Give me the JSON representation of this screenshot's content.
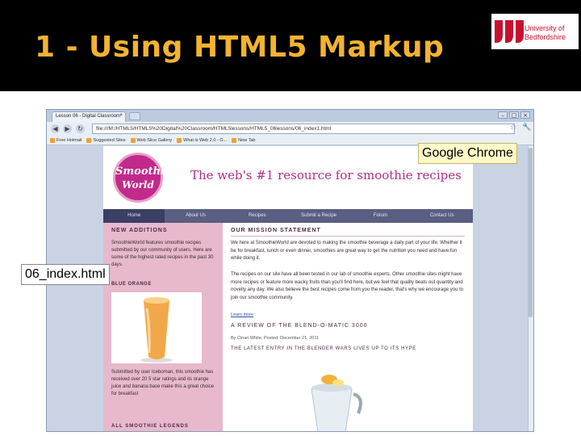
{
  "slide": {
    "title": "1 - Using HTML5 Markup",
    "logo_text": [
      "University of",
      "Bedfordshire"
    ]
  },
  "callouts": {
    "browser": "Google Chrome",
    "file": "06_index.html"
  },
  "browser": {
    "tab_title": "Lesson 06 - Digital Classroom",
    "tab_close": "×",
    "address": "file:///M:/HTML5/HTML5%20Digital%20Classroom/HTML5lessons/HTML5_06lessons/06_index1.html",
    "window_buttons": [
      "–",
      "□",
      "×"
    ],
    "nav_buttons": [
      "◀",
      "▶",
      "↻"
    ],
    "star_icon": "☆",
    "wrench_icon": "🔧",
    "bookmarks": [
      "Free Hotmail",
      "Suggested Sites",
      "Web Slice Gallery",
      "What is Web 2.0 - O...",
      "New Tab"
    ]
  },
  "site": {
    "logo_line1": "Smoothie",
    "logo_line2": "World",
    "tagline": "The web's #1 resource for smoothie recipes",
    "nav": [
      "Home",
      "About Us",
      "Recipes",
      "Submit a Recipe",
      "Forum",
      "Contact Us"
    ],
    "left": {
      "heading": "NEW ADDITIONS",
      "intro": "SmoothieWorld features smoothie recipes submitted by our community of users. Here are some of the highest rated recipes in the past 30 days.",
      "recipe_title": "BLUE ORANGE",
      "recipe_text": "Submitted by user Iceboman, this smoothie has received over 20 5 star ratings and its orange juice and banana base make this a great choice for breakfast",
      "heading2": "ALL SMOOTHIE LEGENDS"
    },
    "right": {
      "heading": "OUR MISSION STATEMENT",
      "p1": "We here at SmoothieWorld are devoted to making the smoothie beverage a daily part of your life. Whether it be for breakfast, lunch or even dinner, smoothies are great way to get the nutrition you need and have fun while doing it.",
      "p2": "The recipes on our site have all been tested in our lab of smoothie experts. Other smoothie sites might have more recipes or feature more wacky fruits than you'll find here, but we feel that quality beats out quantity and novelty any day. We also believe the best recipes come from you the reader, that's why we encourage you to join our smoothie community.",
      "learn_more": "Learn more",
      "review_heading": "A REVIEW OF THE BLEND-O-MATIC 3000",
      "byline": "By Cinari White, Posted: December 21, 2011",
      "review_sub": "THE LATEST ENTRY IN THE BLENDER WARS LIVES UP TO ITS HYPE"
    }
  },
  "colors": {
    "title": "#f3b331",
    "header_band": "#000000",
    "brand_magenta": "#c12a8a",
    "nav_bar": "#5a5e82",
    "sidebar_pink": "#e8b9cd"
  }
}
